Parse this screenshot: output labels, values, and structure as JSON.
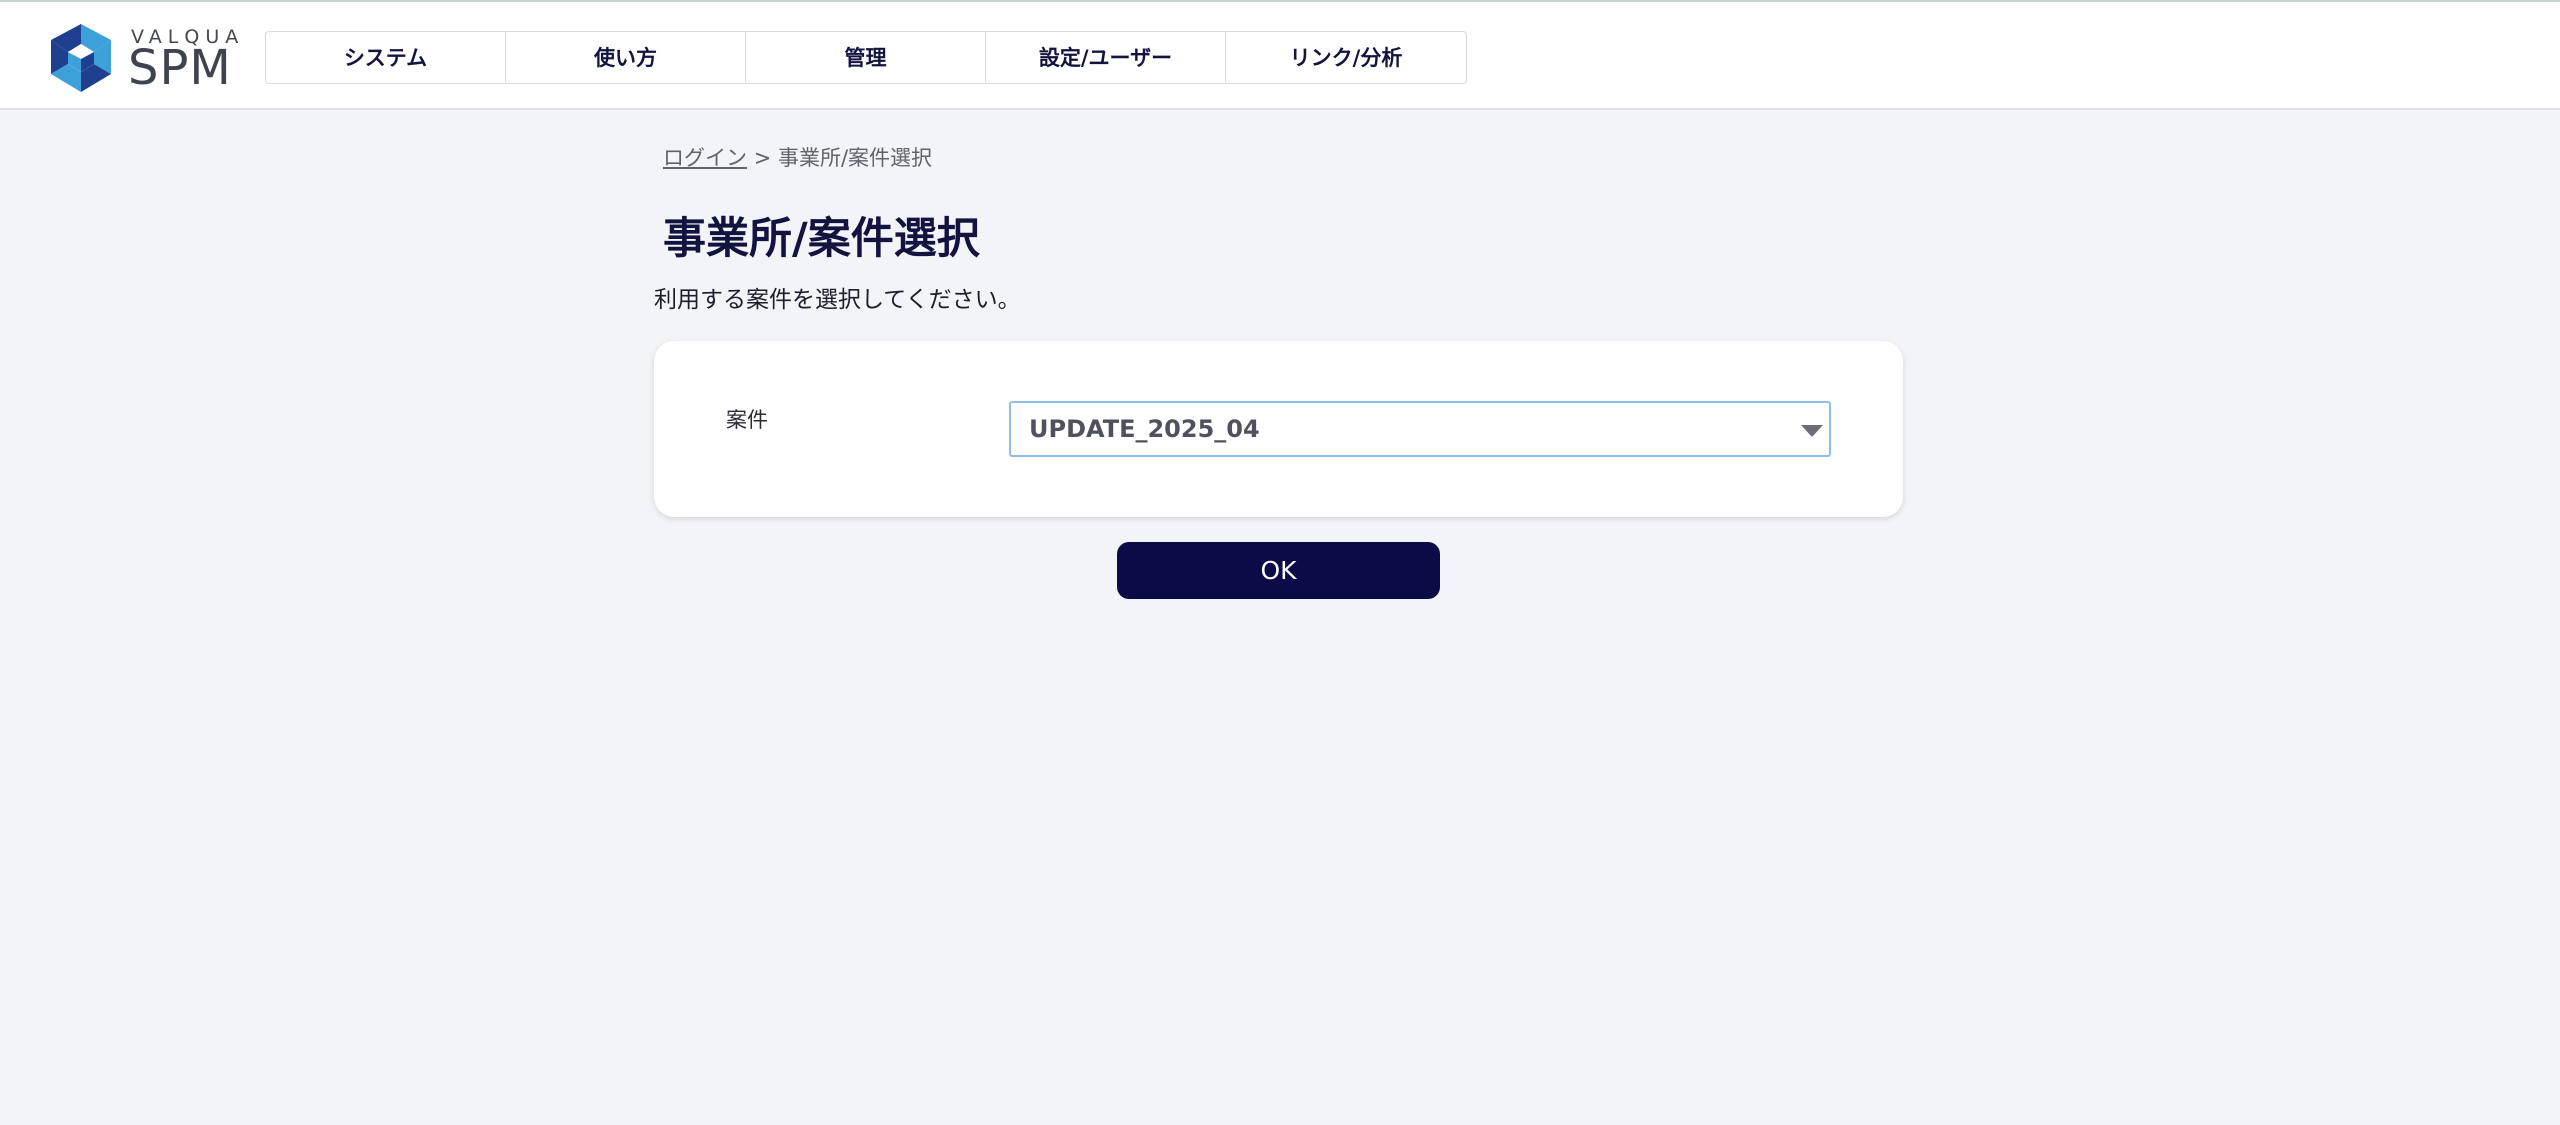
{
  "brand": {
    "company": "VALQUA",
    "product": "SPM",
    "colors": {
      "dark_blue": "#1f3f8f",
      "light_blue": "#3ea0d8",
      "navy": "#12143f"
    }
  },
  "nav": {
    "items": [
      {
        "label": "システム"
      },
      {
        "label": "使い方"
      },
      {
        "label": "管理"
      },
      {
        "label": "設定/ユーザー"
      },
      {
        "label": "リンク/分析"
      }
    ]
  },
  "breadcrumb": {
    "link": "ログイン",
    "separator": ">",
    "current": "事業所/案件選択"
  },
  "page": {
    "title": "事業所/案件選択",
    "instruction": "利用する案件を選択してください。"
  },
  "form": {
    "project_label": "案件",
    "project_value": "UPDATE_2025_04"
  },
  "actions": {
    "ok_label": "OK",
    "ok_color": "#0b0b47"
  }
}
